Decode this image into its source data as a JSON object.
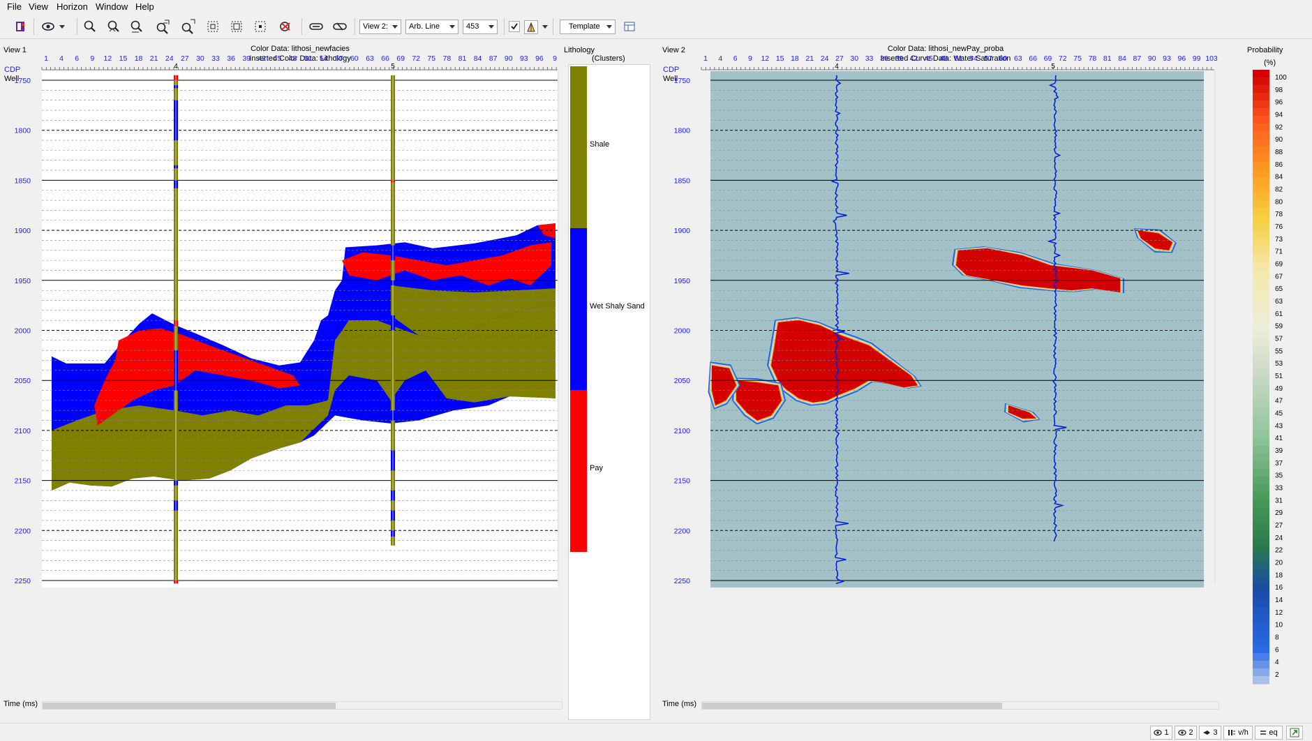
{
  "menu": [
    "File",
    "View",
    "Horizon",
    "Window",
    "Help"
  ],
  "toolbar": {
    "view_combo": "View 2:",
    "line_combo": "Arb. Line",
    "number_combo": "453",
    "template_label": "Template",
    "icons": [
      "open-icon",
      "eye-icon",
      "zoom-icon",
      "zoom-in-icon",
      "zoom-out-icon",
      "zoom-fit-x-icon",
      "zoom-fit-y-icon",
      "fit-box-icon",
      "fit-selection-icon",
      "select-box-icon",
      "clear-icon",
      "link-icon",
      "unlink-icon",
      "checkbox-icon",
      "well-icon",
      "panel-icon"
    ]
  },
  "view1": {
    "name": "View 1",
    "color_data": "Color Data: lithosi_newfacies",
    "inserted": "Inserted Color Data: Lithology",
    "cdp_label": "CDP",
    "well_label": "Well",
    "time_label": "Time (ms)",
    "cdp_ticks": [
      "1",
      "4",
      "6",
      "9",
      "12",
      "15",
      "18",
      "21",
      "24",
      "27",
      "30",
      "33",
      "36",
      "39",
      "42",
      "45",
      "48",
      "51",
      "54",
      "57",
      "60",
      "63",
      "66",
      "69",
      "72",
      "75",
      "78",
      "81",
      "84",
      "87",
      "90",
      "93",
      "96",
      "9"
    ],
    "wells": [
      "4",
      "5"
    ]
  },
  "view2": {
    "name": "View 2",
    "color_data": "Color Data: lithosi_newPay_proba",
    "inserted": "Inserted Curve Data: Water Saturation",
    "cdp_label": "CDP",
    "well_label": "Well",
    "time_label": "Time (ms)",
    "cdp_ticks": [
      "1",
      "4",
      "6",
      "9",
      "12",
      "15",
      "18",
      "21",
      "24",
      "27",
      "30",
      "33",
      "36",
      "39",
      "42",
      "45",
      "48",
      "51",
      "54",
      "57",
      "60",
      "63",
      "66",
      "69",
      "72",
      "75",
      "78",
      "81",
      "84",
      "87",
      "90",
      "93",
      "96",
      "99",
      "103"
    ],
    "wells": [
      "4",
      "5"
    ]
  },
  "time_ticks": [
    "1750",
    "1800",
    "1850",
    "1900",
    "1950",
    "2000",
    "2050",
    "2100",
    "2150",
    "2200",
    "2250"
  ],
  "lithology_legend": {
    "title": "Lithology",
    "subtitle": "(Clusters)",
    "entries": [
      {
        "label": "Shale",
        "color": "#808000"
      },
      {
        "label": "Wet Shaly Sand",
        "color": "#0000ff"
      },
      {
        "label": "Pay",
        "color": "#ff0000"
      },
      {
        "label": "",
        "color": "#ffffff"
      }
    ]
  },
  "probability_legend": {
    "title": "Probability",
    "unit": "(%)",
    "labels": [
      "100",
      "98",
      "96",
      "94",
      "92",
      "90",
      "88",
      "86",
      "84",
      "82",
      "80",
      "78",
      "76",
      "73",
      "71",
      "69",
      "67",
      "65",
      "63",
      "61",
      "59",
      "57",
      "55",
      "53",
      "51",
      "49",
      "47",
      "45",
      "43",
      "41",
      "39",
      "37",
      "35",
      "33",
      "31",
      "29",
      "27",
      "24",
      "22",
      "20",
      "18",
      "16",
      "14",
      "12",
      "10",
      "8",
      "6",
      "4",
      "2"
    ]
  },
  "status": {
    "btn1": "1",
    "btn2": "2",
    "btn3": "3",
    "vh": "v/h",
    "eq": "eq"
  },
  "colors": {
    "shale": "#808000",
    "wet_sand": "#0000ff",
    "pay": "#ff0000",
    "prob_bg": "#a3c2c7",
    "curve": "#0022dd"
  }
}
